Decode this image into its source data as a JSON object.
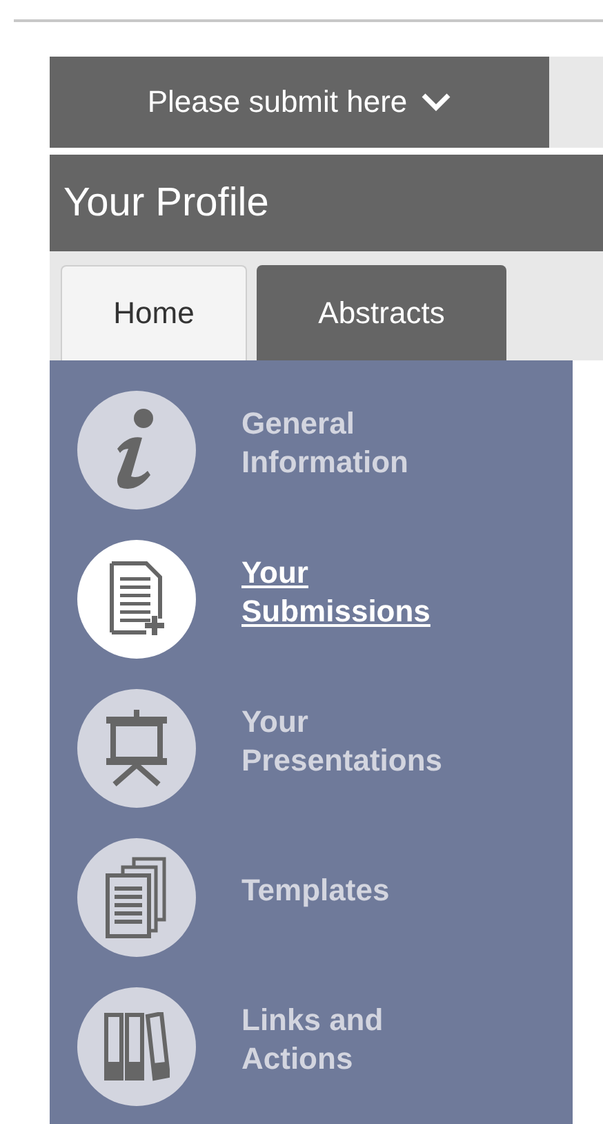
{
  "submit_menu": {
    "label": "Please submit here"
  },
  "profile_header": {
    "title": "Your Profile"
  },
  "tabs": [
    {
      "label": "Home",
      "selected": true
    },
    {
      "label": "Abstracts",
      "selected": false
    }
  ],
  "menu": [
    {
      "label": "General Information",
      "kind": "info",
      "selected": false
    },
    {
      "label": "Your Submissions",
      "kind": "submission",
      "selected": true
    },
    {
      "label": "Your Presentations",
      "kind": "presentation",
      "selected": false
    },
    {
      "label": "Templates",
      "kind": "templates",
      "selected": false
    },
    {
      "label": "Links and Actions",
      "kind": "binders",
      "selected": false
    }
  ]
}
